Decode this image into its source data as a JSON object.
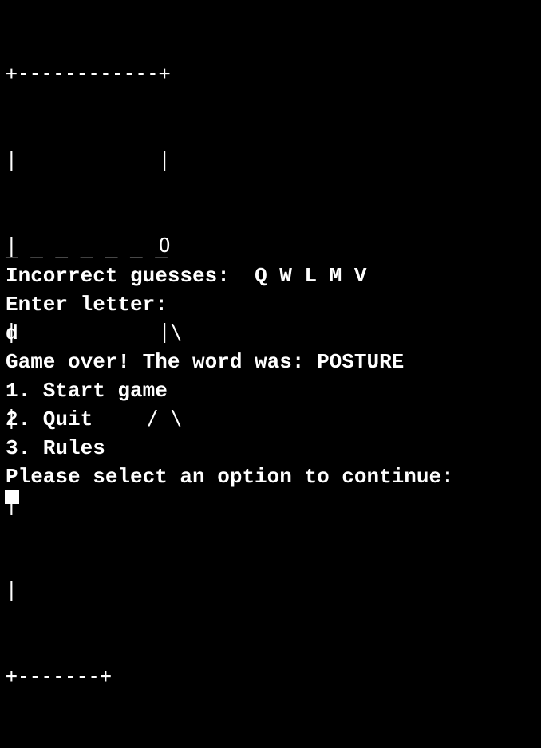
{
  "terminal": {
    "background": "#000000",
    "foreground": "#ffffff",
    "gallows": [
      "+------------+",
      "|            |",
      "|            O",
      "|            |\\",
      "|           / \\",
      "|",
      "|",
      "+-------+"
    ],
    "word_blanks": "_ _ _ _ _ _ _",
    "incorrect_guesses_label": "Incorrect guesses:",
    "incorrect_guesses": "Q W L M V",
    "enter_letter_prompt": "Enter letter:",
    "user_input": "d",
    "game_over_message": "Game over! The word was: POSTURE",
    "menu": {
      "option1": "1. Start game",
      "option2": "2. Quit",
      "option3": "3. Rules",
      "prompt": "Please select an option to continue:"
    }
  }
}
